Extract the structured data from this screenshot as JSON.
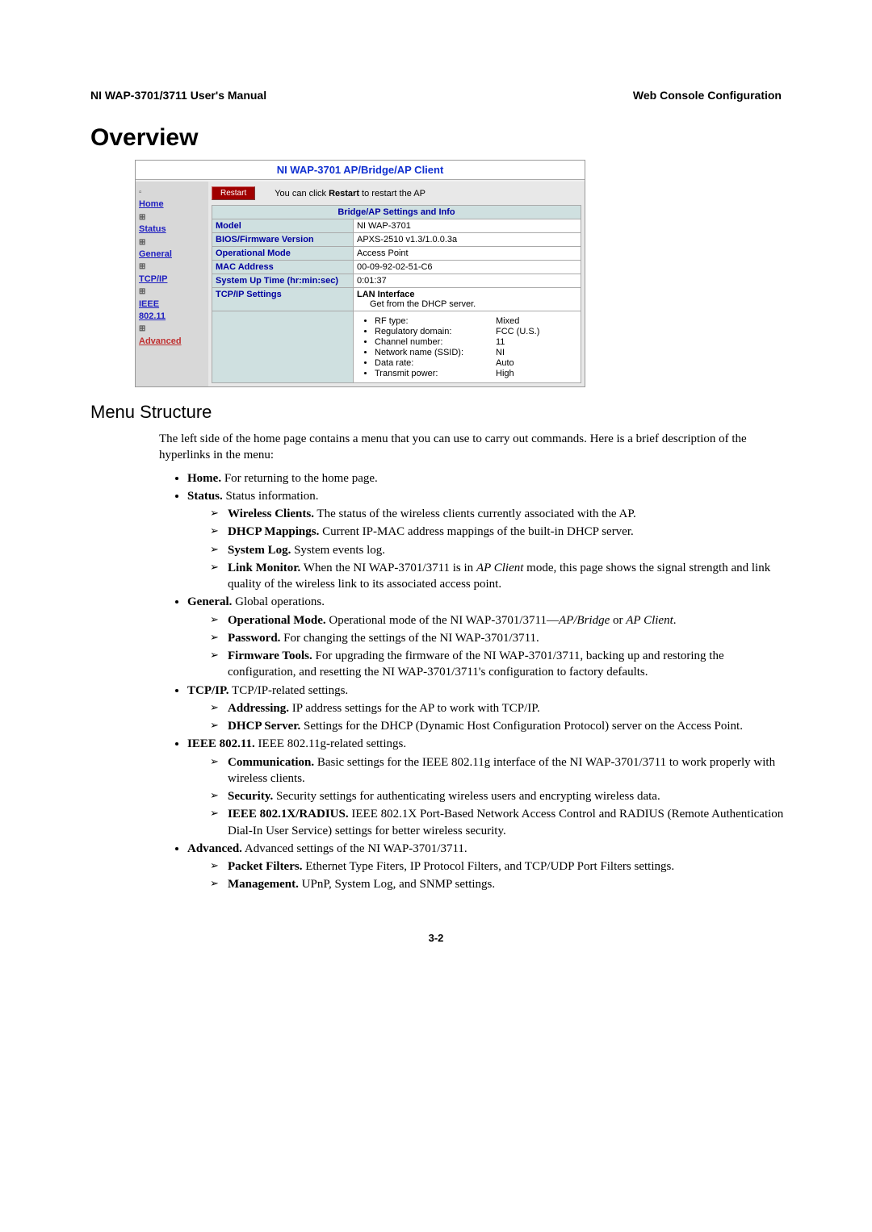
{
  "header": {
    "left": "NI WAP-3701/3711 User's Manual",
    "right": "Web Console Configuration"
  },
  "h1": "Overview",
  "console": {
    "title": "NI WAP-3701 AP/Bridge/AP Client",
    "sidebar": {
      "home": "Home",
      "status": "Status",
      "general": "General",
      "tcpip": "TCP/IP",
      "ieee1": "IEEE",
      "ieee2": "802.11",
      "advanced": "Advanced"
    },
    "restart": {
      "btn": "Restart",
      "text_pre": "You can click ",
      "text_bold": "Restart",
      "text_post": " to restart the AP"
    },
    "table": {
      "heading": "Bridge/AP Settings and Info",
      "model_lbl": "Model",
      "model_val": "NI WAP-3701",
      "bios_lbl": "BIOS/Firmware Version",
      "bios_val": "APXS-2510 v1.3/1.0.0.3a",
      "mode_lbl": "Operational Mode",
      "mode_val": "Access Point",
      "mac_lbl": "MAC Address",
      "mac_val": "00-09-92-02-51-C6",
      "uptime_lbl": "System Up Time (hr:min:sec)",
      "uptime_val": "0:01:37",
      "tcpip_lbl": "TCP/IP Settings",
      "lan_hdr": "LAN Interface",
      "lan_note": "Get from the DHCP server.",
      "rf": {
        "rf_type_k": "RF type:",
        "rf_type_v": "Mixed",
        "reg_k": "Regulatory domain:",
        "reg_v": "FCC (U.S.)",
        "chan_k": "Channel number:",
        "chan_v": "11",
        "ssid_k": "Network name (SSID):",
        "ssid_v": "NI",
        "rate_k": "Data rate:",
        "rate_v": "Auto",
        "power_k": "Transmit power:",
        "power_v": "High"
      }
    }
  },
  "h2": "Menu Structure",
  "intro": "The left side of the home page contains a menu that you can use to carry out commands. Here is a brief description of the hyperlinks in the menu:",
  "menu": {
    "home": {
      "b": "Home.",
      "t": " For returning to the home page."
    },
    "status": {
      "b": "Status.",
      "t": " Status information."
    },
    "status_sub": {
      "wc": {
        "b": "Wireless Clients.",
        "t": " The status of the wireless clients currently associated with the AP."
      },
      "dhcp": {
        "b": "DHCP Mappings.",
        "t": " Current IP-MAC address mappings of the built-in DHCP server."
      },
      "syslog": {
        "b": "System Log.",
        "t": " System events log."
      },
      "linkmon": {
        "b": "Link Monitor.",
        "t1": " When the NI WAP-3701/3711 is in ",
        "i": "AP Client",
        "t2": " mode, this page shows the signal strength and link quality of the wireless link to its associated access point."
      }
    },
    "general": {
      "b": "General.",
      "t": " Global operations."
    },
    "general_sub": {
      "opmode": {
        "b": "Operational Mode.",
        "t1": " Operational mode of the NI WAP-3701/3711—",
        "i1": "AP/Bridge",
        "t2": " or ",
        "i2": "AP Client",
        "t3": "."
      },
      "password": {
        "b": "Password.",
        "t": " For changing the settings of the NI WAP-3701/3711."
      },
      "fw": {
        "b": "Firmware Tools.",
        "t": " For upgrading the firmware of the NI WAP-3701/3711, backing up and restoring the configuration, and resetting the NI WAP-3701/3711's configuration to factory defaults."
      }
    },
    "tcpip": {
      "b": "TCP/IP.",
      "t": " TCP/IP-related settings."
    },
    "tcpip_sub": {
      "addr": {
        "b": "Addressing.",
        "t": " IP address settings for the AP to work with TCP/IP."
      },
      "dhcps": {
        "b": "DHCP Server.",
        "t": " Settings for the DHCP (Dynamic Host Configuration Protocol) server on the Access Point."
      }
    },
    "ieee": {
      "b": "IEEE 802.11.",
      "t": " IEEE 802.11g-related settings."
    },
    "ieee_sub": {
      "comm": {
        "b": "Communication.",
        "t": " Basic settings for the IEEE 802.11g interface of the NI WAP-3701/3711 to work properly with wireless clients."
      },
      "sec": {
        "b": "Security.",
        "t": " Security settings for authenticating wireless users and encrypting wireless data."
      },
      "radius": {
        "b": "IEEE 802.1X/RADIUS.",
        "t": " IEEE 802.1X Port-Based Network Access Control and RADIUS (Remote Authentication Dial-In User Service) settings for better wireless security."
      }
    },
    "advanced": {
      "b": "Advanced.",
      "t": " Advanced settings of the NI WAP-3701/3711."
    },
    "advanced_sub": {
      "pf": {
        "b": "Packet Filters.",
        "t": " Ethernet Type Fiters, IP Protocol Filters, and TCP/UDP Port Filters settings."
      },
      "mgmt": {
        "b": "Management.",
        "t": " UPnP, System Log, and SNMP settings."
      }
    }
  },
  "page_num": "3-2"
}
